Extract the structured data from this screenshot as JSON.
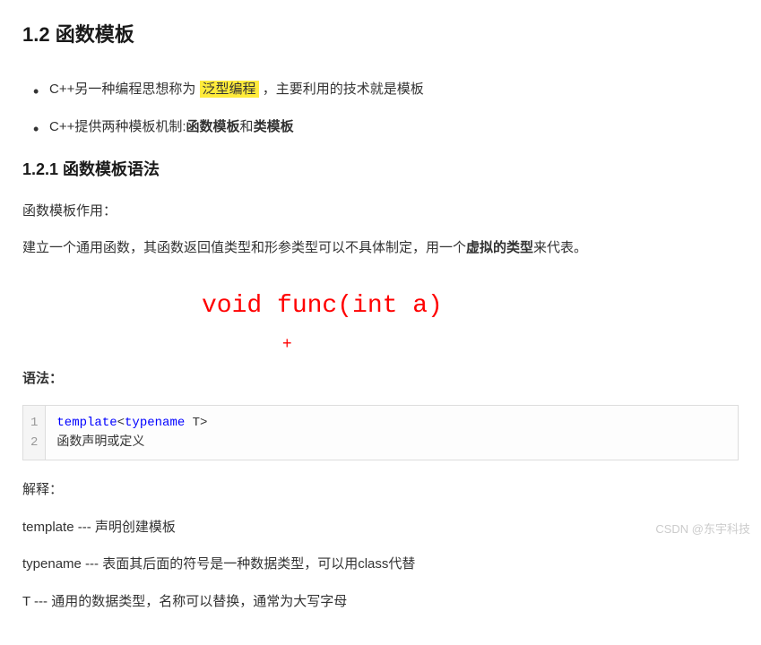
{
  "heading": "1.2 函数模板",
  "bullets": [
    {
      "prefix": "C++另一种编程思想称为 ",
      "highlighted": "泛型编程",
      "middle": " ，主要利用的技术就是模板"
    },
    {
      "prefix": "C++提供两种模板机制:",
      "bold1": "函数模板",
      "middle": "和",
      "bold2": "类模板"
    }
  ],
  "subheading": "1.2.1 函数模板语法",
  "paragraphs": {
    "p1": "函数模板作用：",
    "p2_prefix": "建立一个通用函数，其函数返回值类型和形参类型可以不具体制定，用一个",
    "p2_bold": "虚拟的类型",
    "p2_suffix": "来代表。",
    "annotation": "void func(int a)",
    "plus": "+",
    "syntax_label": "语法：",
    "explain_label": "解释：",
    "exp1": "template --- 声明创建模板",
    "exp2": "typename --- 表面其后面的符号是一种数据类型，可以用class代替",
    "exp3": "T    --- 通用的数据类型，名称可以替换，通常为大写字母"
  },
  "code": {
    "line1_kw1": "template",
    "line1_open": "<",
    "line1_kw2": "typename",
    "line1_rest": " T>",
    "line2": "函数声明或定义"
  },
  "watermark": "CSDN @东宇科技",
  "h3_marker": "H4"
}
